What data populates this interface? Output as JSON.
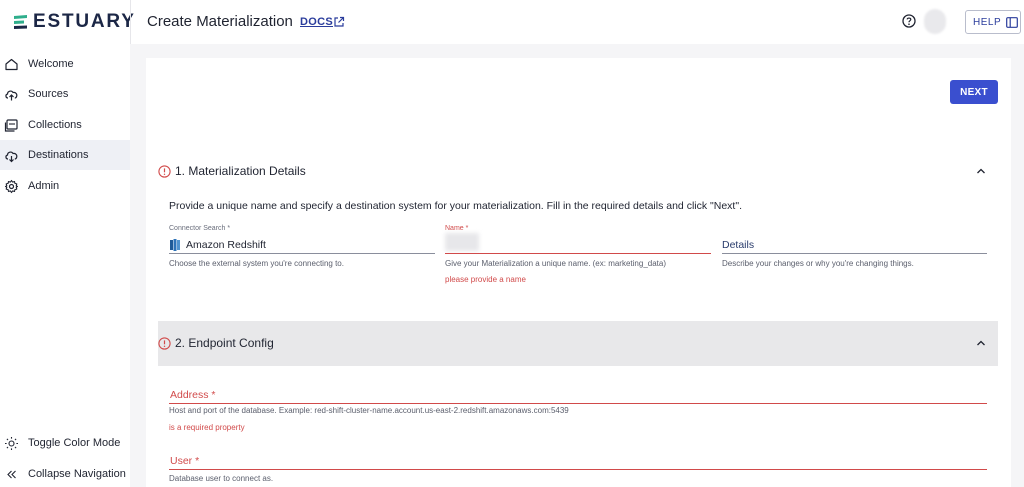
{
  "header": {
    "logo_text": "ESTUARY",
    "page_title": "Create Materialization",
    "docs_label": "DOCS",
    "help_label": "HELP"
  },
  "sidebar": {
    "items": [
      {
        "label": "Welcome",
        "icon": "home-icon"
      },
      {
        "label": "Sources",
        "icon": "cloud-upload-icon"
      },
      {
        "label": "Collections",
        "icon": "collections-icon"
      },
      {
        "label": "Destinations",
        "icon": "cloud-download-icon",
        "active": true
      },
      {
        "label": "Admin",
        "icon": "gear-icon"
      }
    ],
    "bottom": [
      {
        "label": "Toggle Color Mode",
        "icon": "sun-icon"
      },
      {
        "label": "Collapse Navigation",
        "icon": "double-chevron-left-icon"
      }
    ]
  },
  "main": {
    "next_label": "NEXT",
    "section1": {
      "title": "1. Materialization Details",
      "description": "Provide a unique name and specify a destination system for your materialization. Fill in the required details and click \"Next\".",
      "connector": {
        "label": "Connector Search *",
        "value": "Amazon Redshift",
        "help": "Choose the external system you're connecting to."
      },
      "name": {
        "label": "Name *",
        "value": "",
        "help": "Give your Materialization a unique name. (ex: marketing_data)",
        "error": "please provide a name"
      },
      "details": {
        "placeholder": "Details",
        "help": "Describe your changes or why you're changing things."
      }
    },
    "section2": {
      "title": "2. Endpoint Config",
      "address": {
        "label": "Address *",
        "help": "Host and port of the database. Example: red-shift-cluster-name.account.us-east-2.redshift.amazonaws.com:5439",
        "error": "is a required property"
      },
      "user": {
        "label": "User *",
        "help": "Database user to connect as."
      }
    }
  },
  "colors": {
    "accent": "#3a4fcf",
    "error": "#d14a4a",
    "logo": "#1c2746",
    "logo_mark": "#2fae8c"
  }
}
